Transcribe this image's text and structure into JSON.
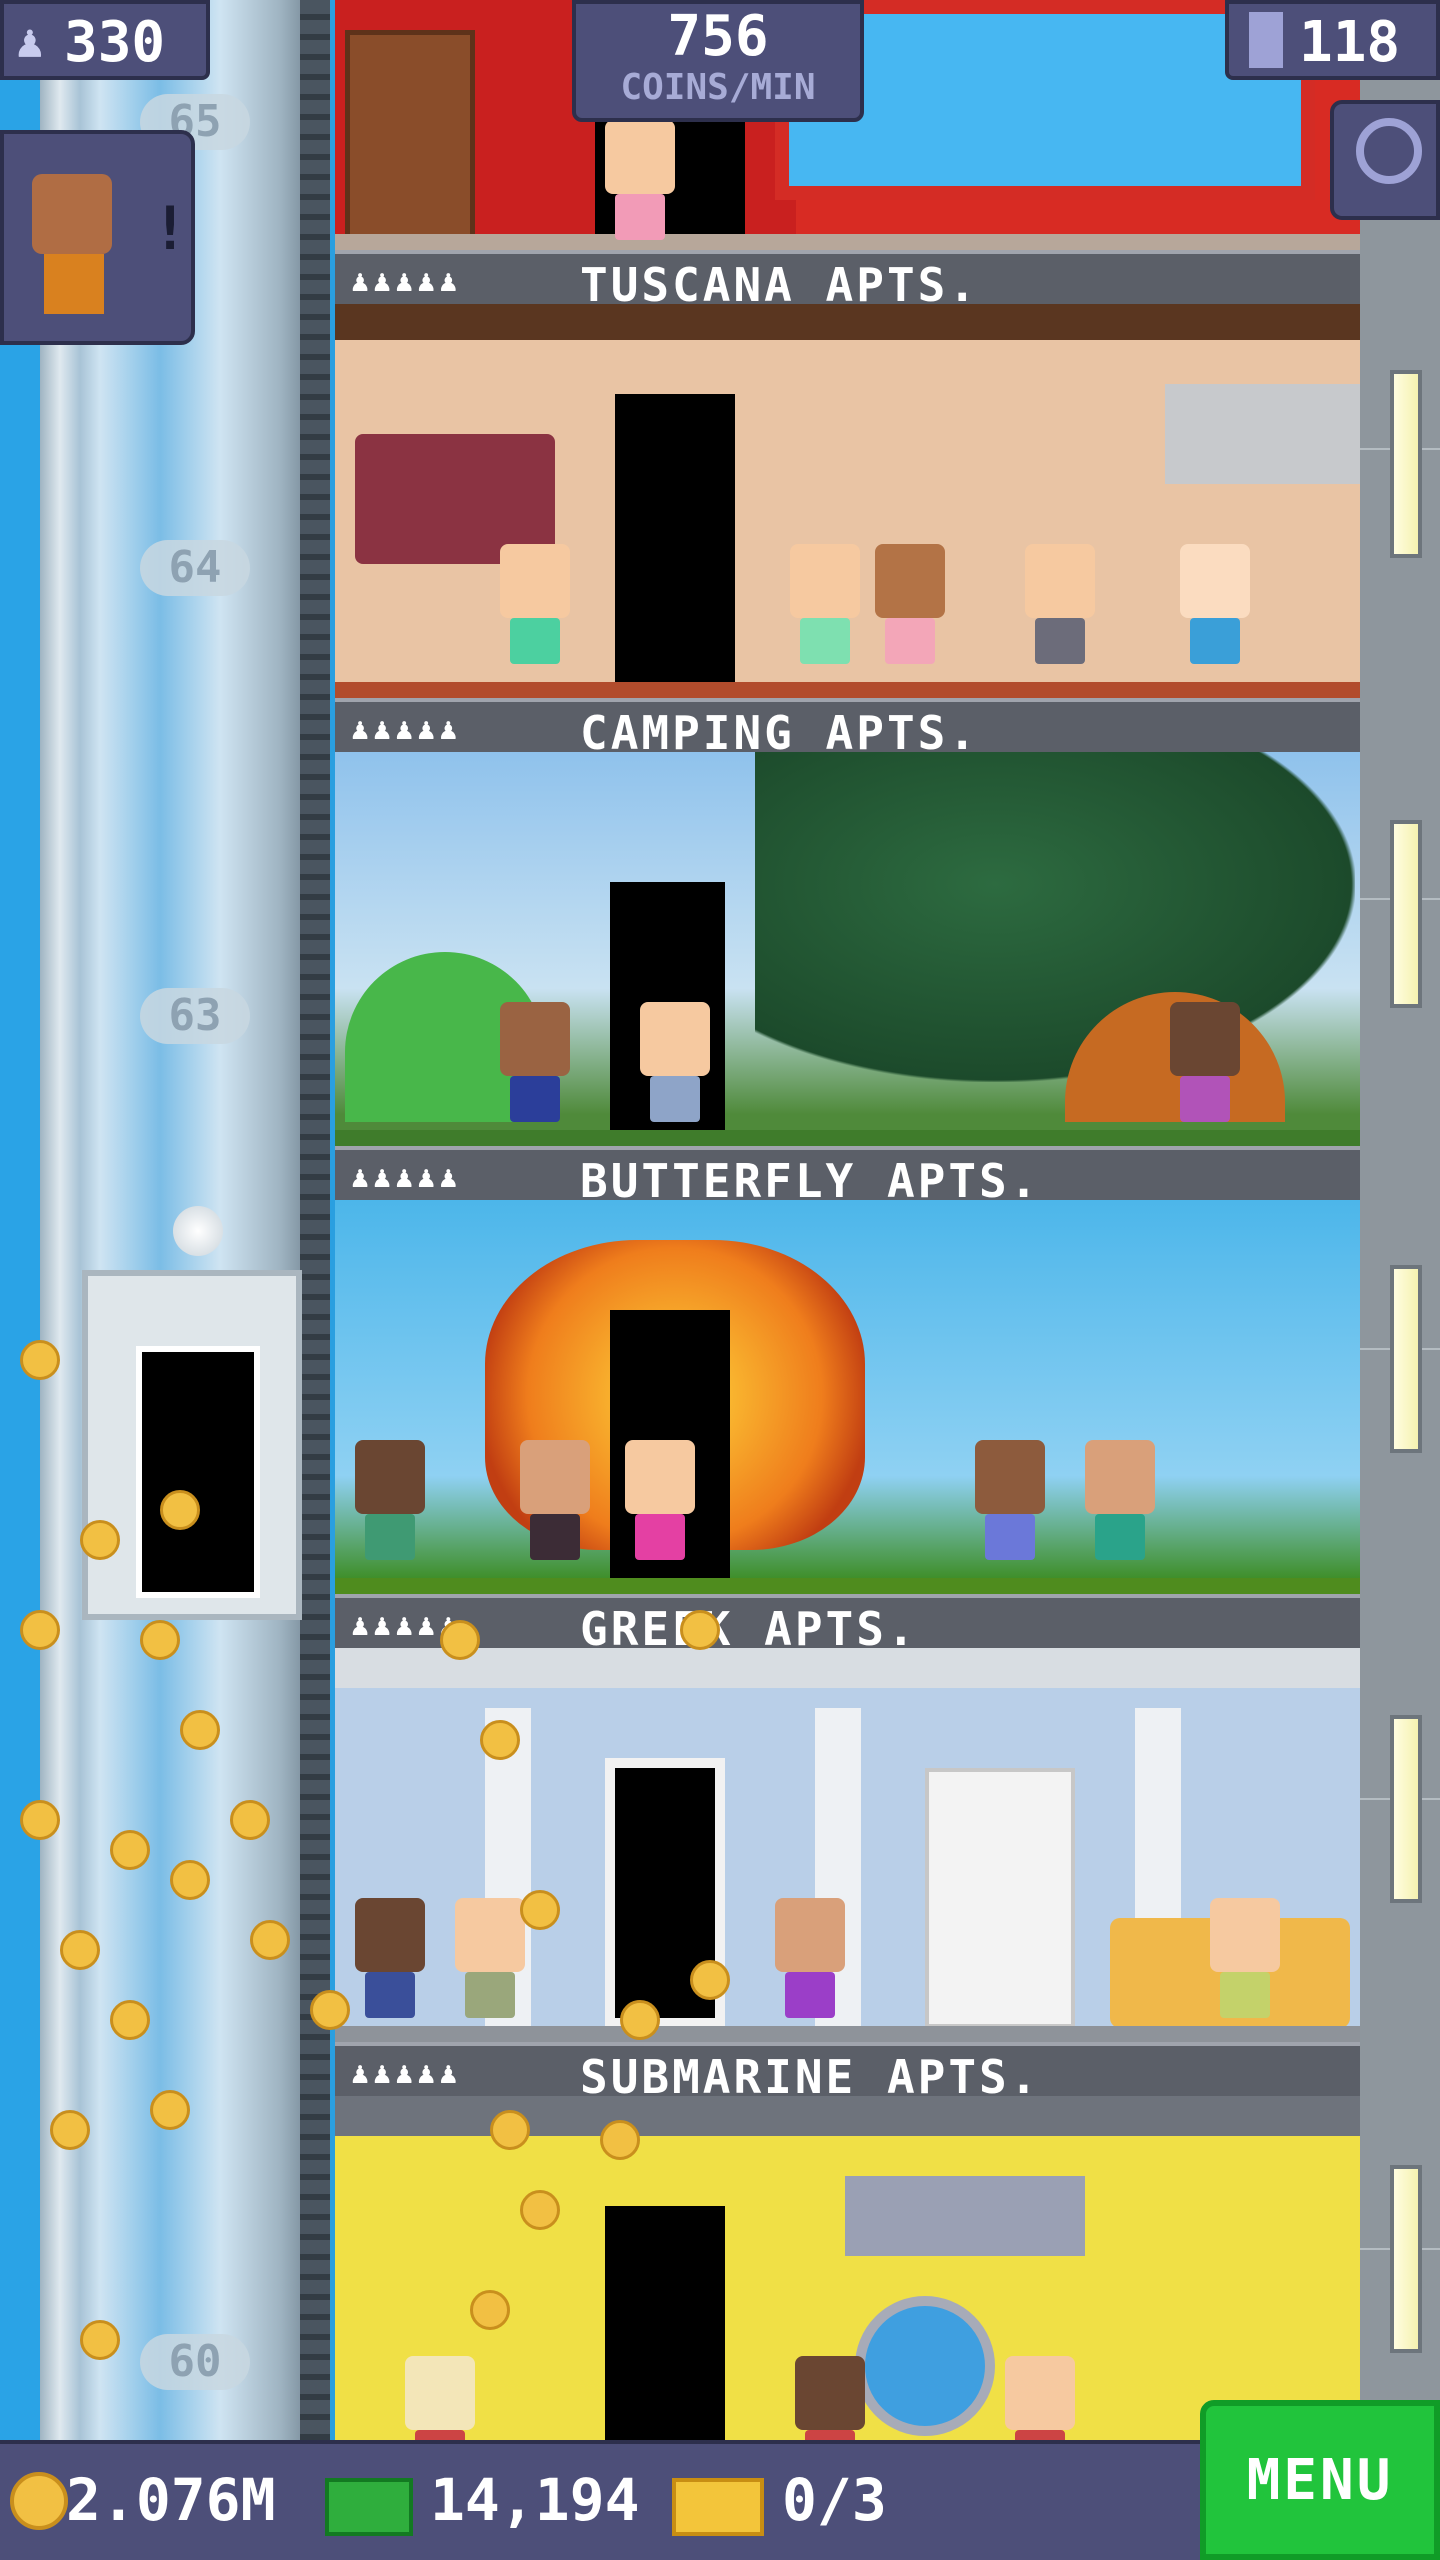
{
  "hud": {
    "population": "330",
    "coins_rate_value": "756",
    "coins_rate_unit": "COINS/MIN",
    "floors": "118"
  },
  "floor_numbers": [
    "65",
    "64",
    "63",
    "60"
  ],
  "floors": [
    {
      "name": "TUSCANA APTS.",
      "people": "♟♟♟♟♟"
    },
    {
      "name": "CAMPING APTS.",
      "people": "♟♟♟♟♟"
    },
    {
      "name": "BUTTERFLY APTS.",
      "people": "♟♟♟♟♟"
    },
    {
      "name": "GREEK APTS.",
      "people": "♟♟♟♟♟"
    },
    {
      "name": "SUBMARINE APTS.",
      "people": "♟♟♟♟♟"
    }
  ],
  "bottom_bar": {
    "coins": "2.076M",
    "bux": "14,194",
    "tickets": "0/3",
    "menu_label": "MENU"
  },
  "icons": {
    "population": "person-icon",
    "floors": "building-icon",
    "search": "magnifier-icon",
    "coins": "coin-icon",
    "bux": "cash-icon",
    "tickets": "ticket-icon"
  },
  "colors": {
    "hud_bg": "#4d4f79",
    "menu_green": "#21c43c",
    "sky_blue": "#2aa3e6"
  }
}
